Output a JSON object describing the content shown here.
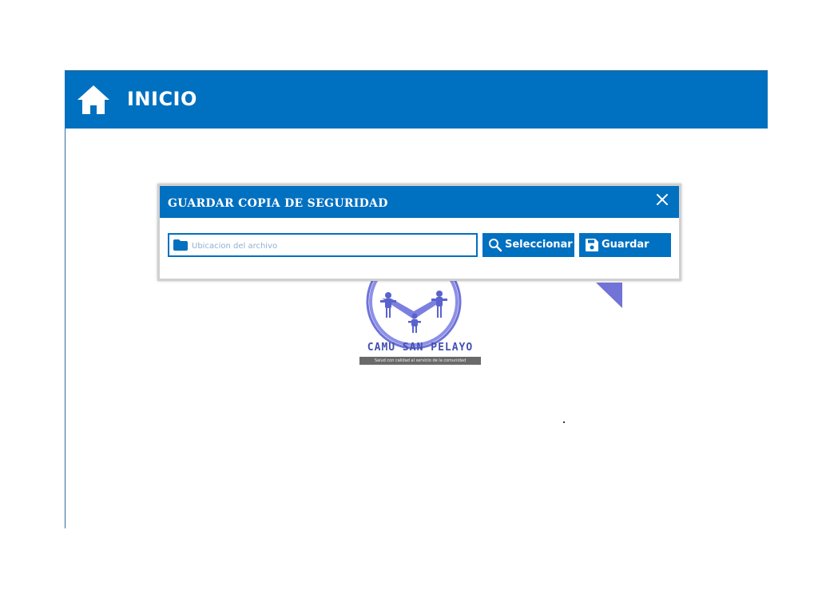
{
  "header": {
    "title": "INICIO",
    "icon": "home-icon"
  },
  "logo": {
    "name": "CAMU SAN PELAYO",
    "slogan": "Salud con calidad al servicio de la comunidad"
  },
  "dialog": {
    "title": "GUARDAR COPIA DE SEGURIDAD",
    "close_icon": "close-icon",
    "file_input": {
      "placeholder": "Ubicacion del archivo",
      "value": "",
      "icon": "folder-icon"
    },
    "select_button": {
      "label": "Seleccionar",
      "icon": "search-icon"
    },
    "save_button": {
      "label": "Guardar",
      "icon": "save-icon"
    }
  },
  "colors": {
    "primary": "#0070c0",
    "accent_triangle": "#7273d6",
    "logo": "#4450b0"
  }
}
